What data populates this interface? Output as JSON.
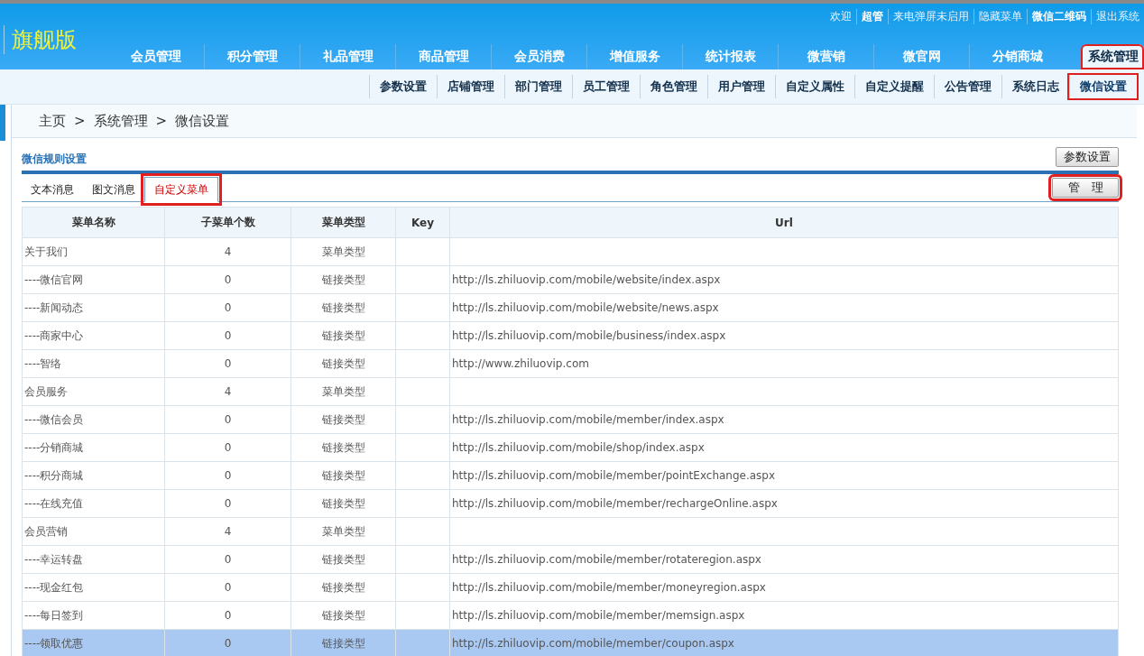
{
  "header": {
    "edition": "旗舰版",
    "top_links": [
      {
        "text": "欢迎",
        "bold": false
      },
      {
        "text": "超管",
        "bold": true
      },
      {
        "text": "来电弹屏未启用",
        "bold": false
      },
      {
        "text": "隐藏菜单",
        "bold": false
      },
      {
        "text": "微信二维码",
        "bold": true
      },
      {
        "text": "退出系统",
        "bold": false
      }
    ],
    "nav": [
      {
        "label": "会员管理",
        "selected": false,
        "highlighted": false
      },
      {
        "label": "积分管理",
        "selected": false,
        "highlighted": false
      },
      {
        "label": "礼品管理",
        "selected": false,
        "highlighted": false
      },
      {
        "label": "商品管理",
        "selected": false,
        "highlighted": false
      },
      {
        "label": "会员消费",
        "selected": false,
        "highlighted": false
      },
      {
        "label": "增值服务",
        "selected": false,
        "highlighted": false
      },
      {
        "label": "统计报表",
        "selected": false,
        "highlighted": false
      },
      {
        "label": "微营销",
        "selected": false,
        "highlighted": false
      },
      {
        "label": "微官网",
        "selected": false,
        "highlighted": false
      },
      {
        "label": "分销商城",
        "selected": false,
        "highlighted": false
      },
      {
        "label": "系统管理",
        "selected": true,
        "highlighted": true
      }
    ]
  },
  "sub_nav": [
    {
      "label": "参数设置",
      "selected": false,
      "highlighted": false
    },
    {
      "label": "店铺管理",
      "selected": false,
      "highlighted": false
    },
    {
      "label": "部门管理",
      "selected": false,
      "highlighted": false
    },
    {
      "label": "员工管理",
      "selected": false,
      "highlighted": false
    },
    {
      "label": "角色管理",
      "selected": false,
      "highlighted": false
    },
    {
      "label": "用户管理",
      "selected": false,
      "highlighted": false
    },
    {
      "label": "自定义属性",
      "selected": false,
      "highlighted": false
    },
    {
      "label": "自定义提醒",
      "selected": false,
      "highlighted": false
    },
    {
      "label": "公告管理",
      "selected": false,
      "highlighted": false
    },
    {
      "label": "系统日志",
      "selected": false,
      "highlighted": false
    },
    {
      "label": "微信设置",
      "selected": true,
      "highlighted": true
    }
  ],
  "breadcrumb": [
    {
      "text": "主页"
    },
    {
      "text": ">"
    },
    {
      "text": "系统管理"
    },
    {
      "text": ">"
    },
    {
      "text": "微信设置"
    }
  ],
  "section": {
    "title": "微信规则设置",
    "settings_button": "参数设置"
  },
  "tabs": [
    {
      "label": "文本消息",
      "selected": false,
      "highlighted": false
    },
    {
      "label": "图文消息",
      "selected": false,
      "highlighted": false
    },
    {
      "label": "自定义菜单",
      "selected": true,
      "highlighted": true
    }
  ],
  "manage_button": {
    "label": "管　理",
    "highlighted": true
  },
  "table": {
    "columns": [
      "菜单名称",
      "子菜单个数",
      "菜单类型",
      "Key",
      "Url"
    ],
    "rows": [
      {
        "cells": [
          "关于我们",
          "4",
          "菜单类型",
          "",
          ""
        ],
        "selected": false
      },
      {
        "cells": [
          "----微信官网",
          "0",
          "链接类型",
          "",
          "http://ls.zhiluovip.com/mobile/website/index.aspx"
        ],
        "selected": false
      },
      {
        "cells": [
          "----新闻动态",
          "0",
          "链接类型",
          "",
          "http://ls.zhiluovip.com/mobile/website/news.aspx"
        ],
        "selected": false
      },
      {
        "cells": [
          "----商家中心",
          "0",
          "链接类型",
          "",
          "http://ls.zhiluovip.com/mobile/business/index.aspx"
        ],
        "selected": false
      },
      {
        "cells": [
          "----智络",
          "0",
          "链接类型",
          "",
          "http://www.zhiluovip.com"
        ],
        "selected": false
      },
      {
        "cells": [
          "会员服务",
          "4",
          "菜单类型",
          "",
          ""
        ],
        "selected": false
      },
      {
        "cells": [
          "----微信会员",
          "0",
          "链接类型",
          "",
          "http://ls.zhiluovip.com/mobile/member/index.aspx"
        ],
        "selected": false
      },
      {
        "cells": [
          "----分销商城",
          "0",
          "链接类型",
          "",
          "http://ls.zhiluovip.com/mobile/shop/index.aspx"
        ],
        "selected": false
      },
      {
        "cells": [
          "----积分商城",
          "0",
          "链接类型",
          "",
          "http://ls.zhiluovip.com/mobile/member/pointExchange.aspx"
        ],
        "selected": false
      },
      {
        "cells": [
          "----在线充值",
          "0",
          "链接类型",
          "",
          "http://ls.zhiluovip.com/mobile/member/rechargeOnline.aspx"
        ],
        "selected": false
      },
      {
        "cells": [
          "会员营销",
          "4",
          "菜单类型",
          "",
          ""
        ],
        "selected": false
      },
      {
        "cells": [
          "----幸运转盘",
          "0",
          "链接类型",
          "",
          "http://ls.zhiluovip.com/mobile/member/rotateregion.aspx"
        ],
        "selected": false
      },
      {
        "cells": [
          "----现金红包",
          "0",
          "链接类型",
          "",
          "http://ls.zhiluovip.com/mobile/member/moneyregion.aspx"
        ],
        "selected": false
      },
      {
        "cells": [
          "----每日签到",
          "0",
          "链接类型",
          "",
          "http://ls.zhiluovip.com/mobile/member/memsign.aspx"
        ],
        "selected": false
      },
      {
        "cells": [
          "----领取优惠",
          "0",
          "链接类型",
          "",
          "http://ls.zhiluovip.com/mobile/member/coupon.aspx"
        ],
        "selected": true
      }
    ]
  }
}
